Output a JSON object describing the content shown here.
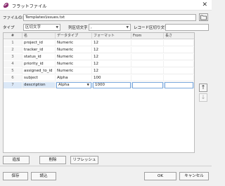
{
  "window": {
    "title": "フラットファイル",
    "close_glyph": "✕"
  },
  "form": {
    "file_name_label": "ファイルの名",
    "file_name_value": "Templates\\issues.txt",
    "type_label": "タイプ",
    "type_value": "区切文字",
    "column_delimiter_label": "列区切文字",
    "column_delimiter_value": ",",
    "record_delimiter_label": "レコード区切り文字",
    "record_delimiter_value": ""
  },
  "grid": {
    "columns": [
      "#",
      "名",
      "データタイプ",
      "フォーマット",
      "From",
      "長さ"
    ],
    "rows": [
      {
        "num": "1",
        "name": "project_id",
        "type": "Numeric",
        "format": "12",
        "from": "",
        "length": ""
      },
      {
        "num": "2",
        "name": "tracker_id",
        "type": "Numeric",
        "format": "12",
        "from": "",
        "length": ""
      },
      {
        "num": "3",
        "name": "status_id",
        "type": "Numeric",
        "format": "12",
        "from": "",
        "length": ""
      },
      {
        "num": "4",
        "name": "priority_id",
        "type": "Numeric",
        "format": "12",
        "from": "",
        "length": ""
      },
      {
        "num": "5",
        "name": "assigned_to_id",
        "type": "Numeric",
        "format": "12",
        "from": "",
        "length": ""
      },
      {
        "num": "6",
        "name": "subject",
        "type": "Alpha",
        "format": "100",
        "from": "",
        "length": ""
      },
      {
        "num": "7",
        "name": "description",
        "type": "Alpha",
        "format": "1000",
        "from": "",
        "length": ""
      }
    ]
  },
  "buttons": {
    "add": "追加",
    "delete": "削除",
    "refresh": "リフレッシュ",
    "save": "保存",
    "load": "読込",
    "ok": "OK",
    "cancel": "キャンセル",
    "up_glyph": "↑",
    "down_glyph": "↓"
  },
  "colors": {
    "brand": "#8a2b6e",
    "selection": "#dbe8f7",
    "edit_border": "#7aa7db"
  },
  "icons": {
    "app": "app-logo-icon",
    "folder": "folder-icon",
    "close": "close-icon",
    "move_up": "arrow-up-icon",
    "move_down": "arrow-down-icon"
  }
}
